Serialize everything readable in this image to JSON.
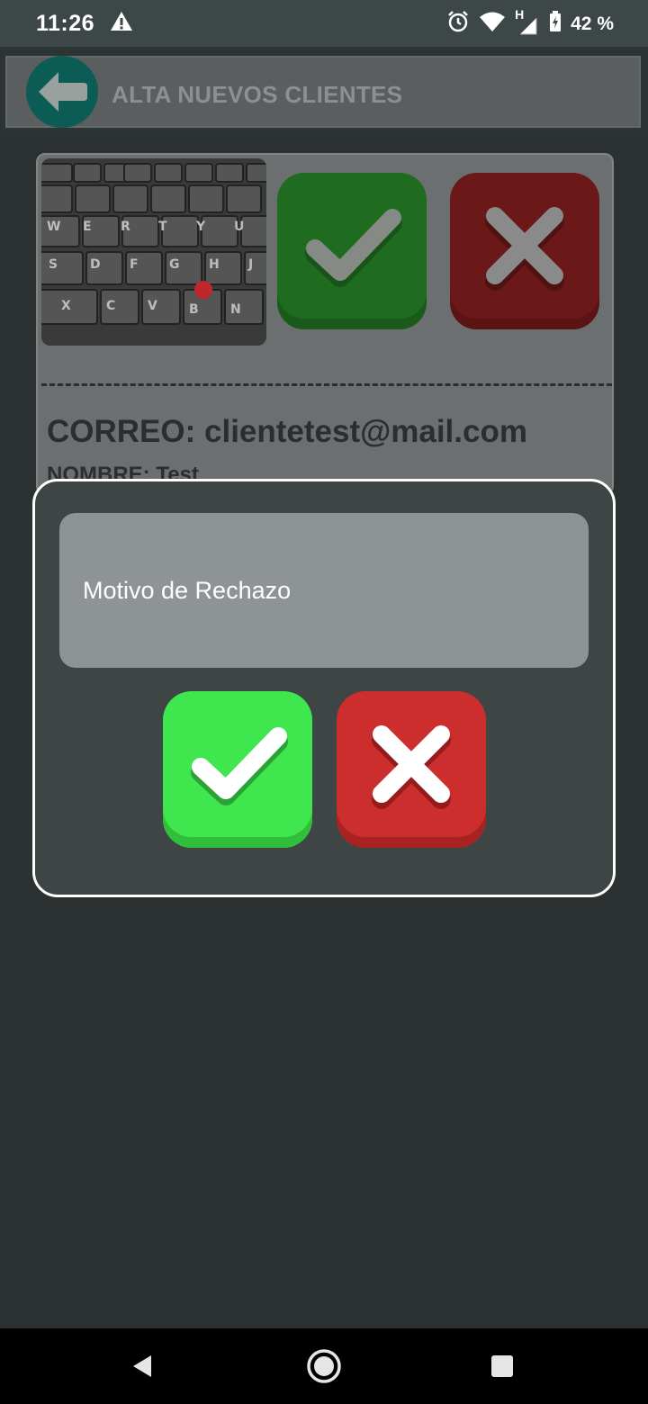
{
  "status_bar": {
    "time": "11:26",
    "icons": [
      "warning-icon",
      "alarm-icon",
      "wifi-icon",
      "signal-icon",
      "battery-icon"
    ],
    "network_type": "H",
    "battery": "42 %"
  },
  "toolbar": {
    "title": "ALTA NUEVOS CLIENTES",
    "back_icon": "back-arrow-icon",
    "accent_color": "#0b5c55"
  },
  "card": {
    "email_label": "CORREO: clientetest@mail.com",
    "name_label": "NOMBRE: Test",
    "image": "keyboard-photo",
    "approve_icon": "check-icon",
    "reject_icon": "close-icon"
  },
  "dialog": {
    "reason_placeholder": "Motivo de Rechazo",
    "confirm_color": "#40e64e",
    "cancel_color": "#cc2d2d"
  },
  "nav_bar": {
    "items": [
      "back-icon",
      "home-icon",
      "recents-icon"
    ]
  }
}
